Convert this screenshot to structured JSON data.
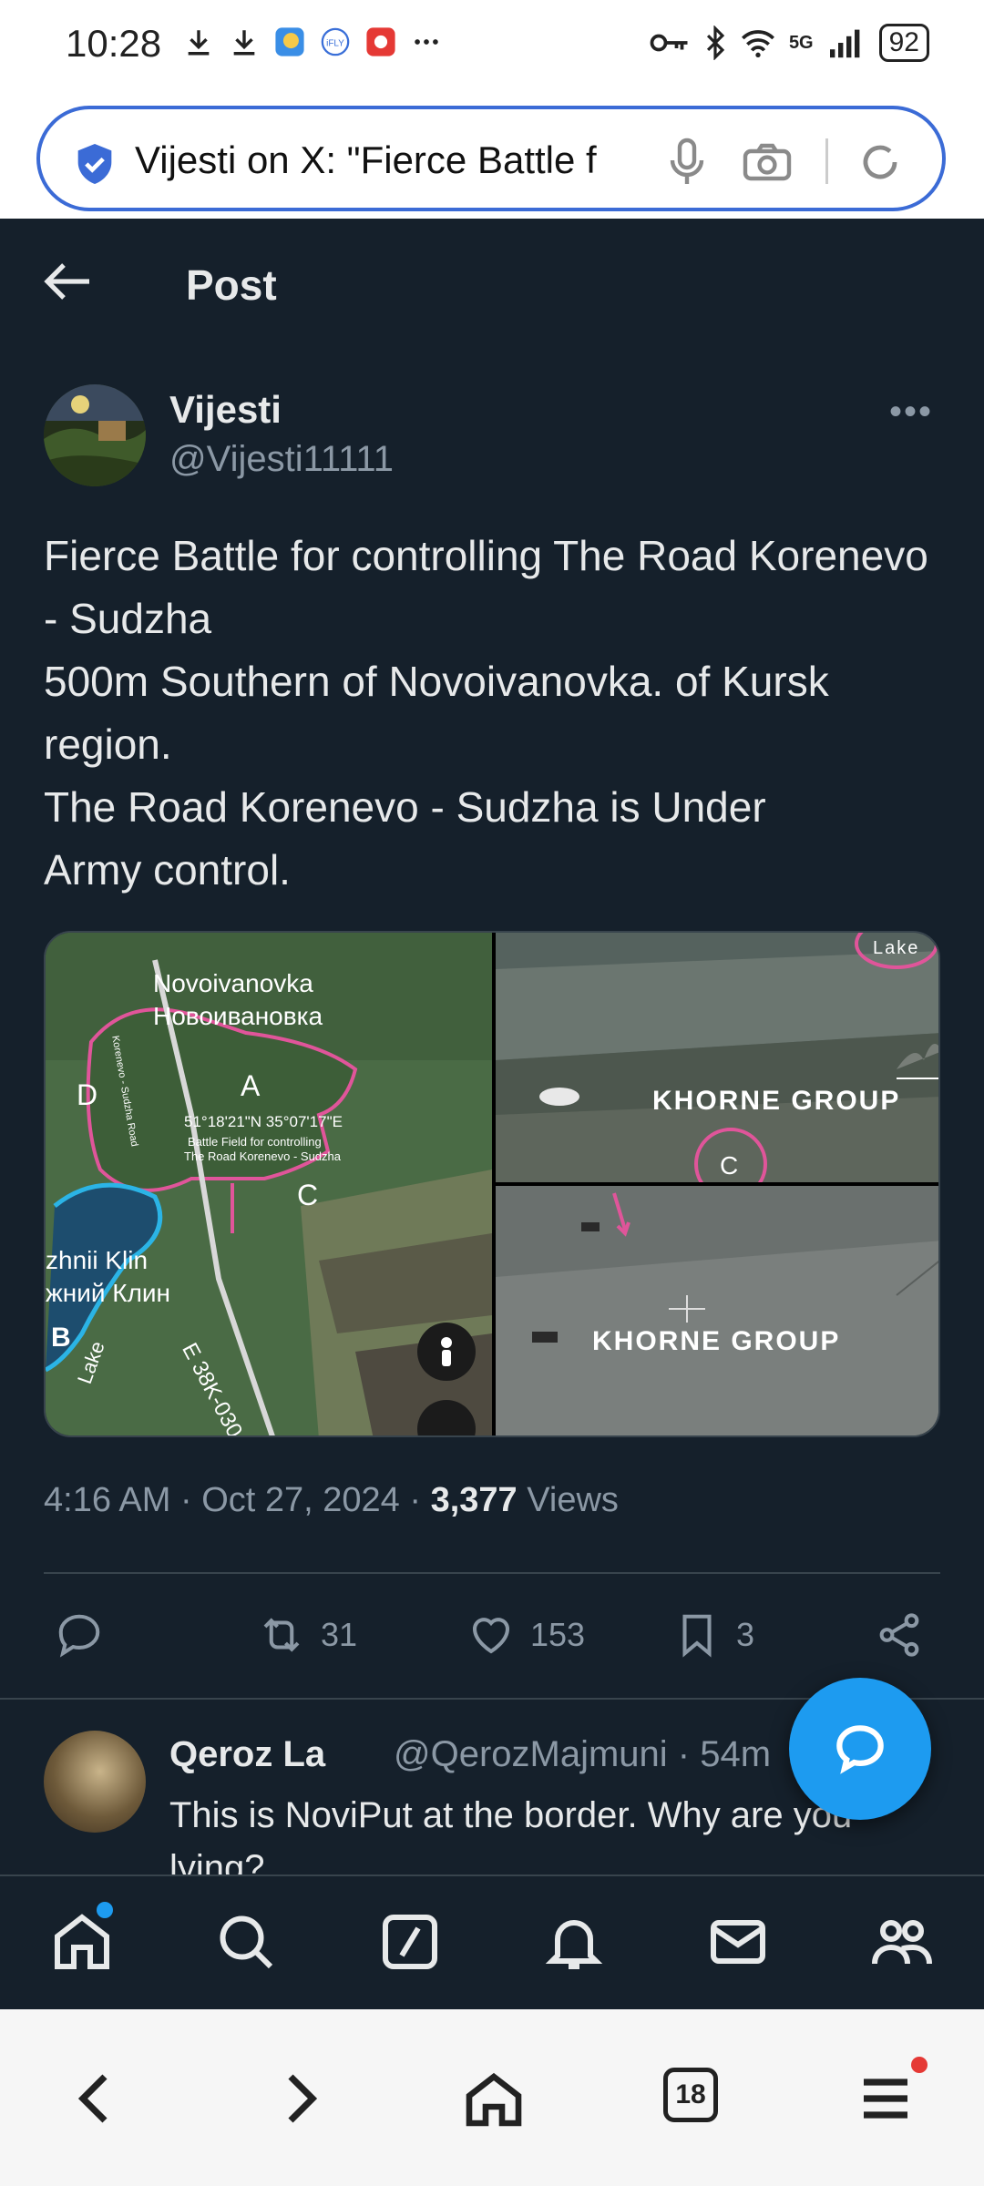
{
  "status_bar": {
    "time": "10:28",
    "signal_label": "5G",
    "battery": "92"
  },
  "url_bar": {
    "text": "Vijesti on X: \"Fierce Battle f"
  },
  "header": {
    "title": "Post"
  },
  "post": {
    "author_name": "Vijesti",
    "author_handle": "@Vijesti11111",
    "text_lines": [
      "Fierce Battle  for controlling The Road Korenevo - Sudzha",
      "500m Southern of Novoivanovka. of Kursk region.",
      "The Road Korenevo - Sudzha is Under",
      "Army control."
    ],
    "media": {
      "map_labels": {
        "town_latin": "Novoivanovka",
        "town_cyrillic": "Новоивановка",
        "label_a": "A",
        "label_c": "C",
        "label_d": "D",
        "label_b": "B",
        "coords": "51°18'21\"N 35°07'17\"E",
        "caption_1": "Battle Field for controlling",
        "caption_2": "The Road Korenevo - Sudzha",
        "village_latin": "zhnii Klin",
        "village_cyrillic": "жний Клин",
        "road": "E 38K-030",
        "lake": "Lake",
        "road_side": "Korenevo - Sudzha Road"
      },
      "video_top": {
        "watermark": "KHORNE GROUP",
        "label_c": "C",
        "lake": "Lake"
      },
      "video_bottom": {
        "watermark": "KHORNE GROUP"
      }
    },
    "timestamp": "4:16 AM · Oct 27, 2024 · ",
    "views_count": "3,377",
    "views_label": " Views",
    "actions": {
      "reposts": "31",
      "likes": "153",
      "bookmarks": "3"
    }
  },
  "reply": {
    "name": "Qeroz La",
    "handle": "@QerozMajmuni · 54m",
    "text": "This is NoviPut at the border. Why are you lying?"
  },
  "colors": {
    "background": "#15202b",
    "accent": "#1d9bf0",
    "muted": "#8b98a5",
    "divider": "#38444d"
  },
  "icons": {
    "bottom_nav": [
      "home-icon",
      "search-icon",
      "grok-icon",
      "notifications-icon",
      "messages-icon",
      "communities-icon"
    ],
    "browser_bar": [
      "back-icon",
      "forward-icon",
      "home-icon",
      "tabs-icon",
      "menu-icon"
    ]
  },
  "browser": {
    "tab_count": "18"
  }
}
